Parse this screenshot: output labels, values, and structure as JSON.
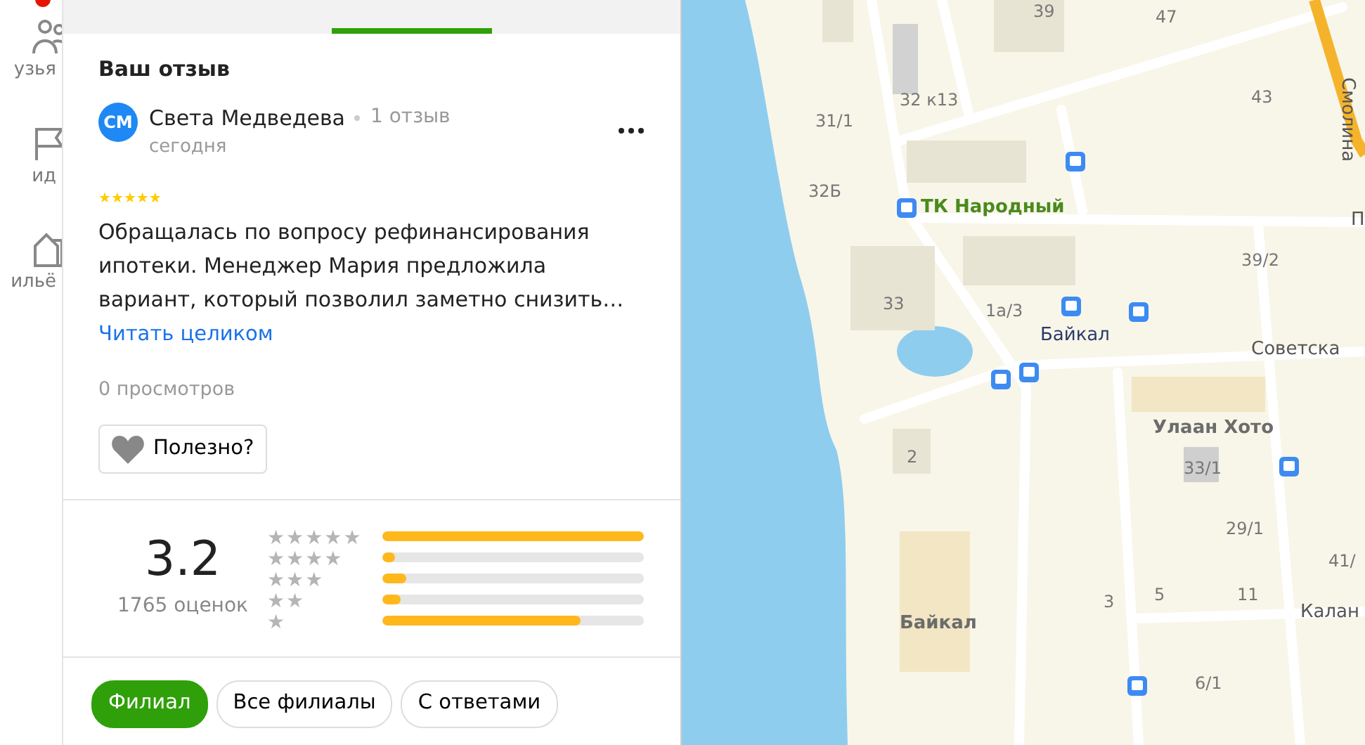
{
  "nav": [
    {
      "label": "узья",
      "kind": "friends"
    },
    {
      "label": "ид",
      "kind": "guide"
    },
    {
      "label": "ильё",
      "kind": "housing"
    }
  ],
  "nav_badge": true,
  "tabs": [
    {
      "selected": true
    }
  ],
  "review_section": {
    "title": "Ваш отзыв",
    "review": {
      "avatar": "СМ",
      "author": "Света Медведева",
      "count": "1 отзыв",
      "date": "сегодня",
      "stars": 5,
      "text": "Обращалась по вопросу рефинансирования ипотеки. Менеджер Мария предложила вариант, который позволил заметно снизить…",
      "read_more": "Читать целиком",
      "views": "0 просмотров",
      "useful": "Полезно?",
      "liked": false
    }
  },
  "summary": {
    "score": "3.2",
    "count": "1765 оценок",
    "bars": [
      {
        "label": "★★★★★",
        "level": 1.0
      },
      {
        "label": "★★★★",
        "level": 0.05
      },
      {
        "label": "★★★",
        "level": 0.09
      },
      {
        "label": "★★",
        "level": 0.07
      },
      {
        "label": "★",
        "level": 0.76
      }
    ]
  },
  "filters": [
    {
      "label": "Филиал",
      "selected": true
    },
    {
      "label": "Все филиалы",
      "selected": false
    },
    {
      "label": "С ответами",
      "selected": false
    }
  ],
  "map": {
    "labels": [
      {
        "text": "39",
        "kind": "number"
      },
      {
        "text": "47",
        "kind": "number"
      },
      {
        "text": "32 к13",
        "kind": "number"
      },
      {
        "text": "31/1",
        "kind": "number"
      },
      {
        "text": "32Б",
        "kind": "number"
      },
      {
        "text": "43",
        "kind": "number"
      },
      {
        "text": "Смолина",
        "kind": "street"
      },
      {
        "text": "ТК Народный",
        "kind": "poi"
      },
      {
        "text": "39/2",
        "kind": "number"
      },
      {
        "text": "33",
        "kind": "number"
      },
      {
        "text": "1а/3",
        "kind": "number"
      },
      {
        "text": "Байкал",
        "kind": "stop"
      },
      {
        "text": "Советска",
        "kind": "street"
      },
      {
        "text": "Улаан Хото",
        "kind": "place"
      },
      {
        "text": "2",
        "kind": "number"
      },
      {
        "text": "33/1",
        "kind": "number"
      },
      {
        "text": "29/1",
        "kind": "number"
      },
      {
        "text": "41/",
        "kind": "number"
      },
      {
        "text": "Байкал",
        "kind": "place"
      },
      {
        "text": "3",
        "kind": "number"
      },
      {
        "text": "5",
        "kind": "number"
      },
      {
        "text": "11",
        "kind": "number"
      },
      {
        "text": "Калан",
        "kind": "street"
      },
      {
        "text": "6/1",
        "kind": "number"
      },
      {
        "text": "П",
        "kind": "street"
      }
    ]
  }
}
